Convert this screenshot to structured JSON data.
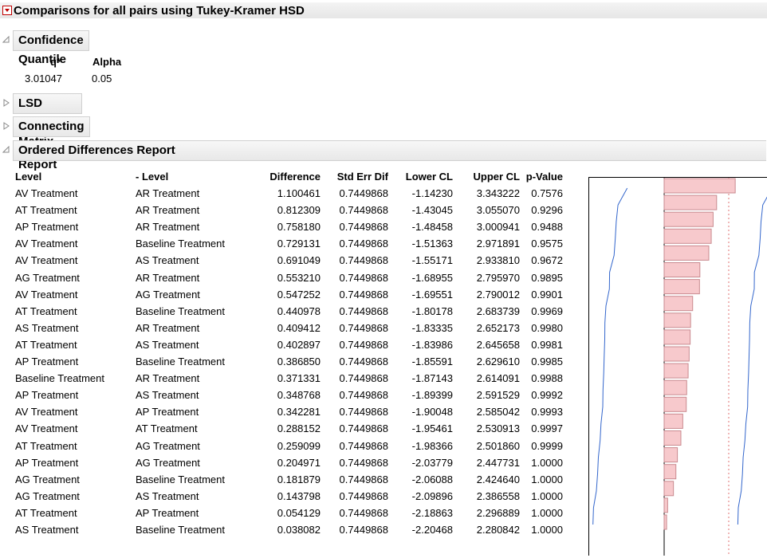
{
  "report": {
    "title": "Comparisons for all pairs using Tukey-Kramer HSD"
  },
  "confidence_quantile": {
    "title": "Confidence Quantile",
    "headers": [
      "q*",
      "Alpha"
    ],
    "values": [
      "3.01047",
      "0.05"
    ]
  },
  "lsd_threshold": {
    "title": "LSD Threshold Matrix"
  },
  "connecting_letters": {
    "title": "Connecting Letters Report"
  },
  "ordered_differences": {
    "title": "Ordered Differences Report",
    "headers": [
      "Level",
      "- Level",
      "Difference",
      "Std Err Dif",
      "Lower CL",
      "Upper CL",
      "p-Value"
    ],
    "rows": [
      [
        "AV Treatment",
        "AR Treatment",
        "1.100461",
        "0.7449868",
        "-1.14230",
        "3.343222",
        "0.7576"
      ],
      [
        "AT Treatment",
        "AR Treatment",
        "0.812309",
        "0.7449868",
        "-1.43045",
        "3.055070",
        "0.9296"
      ],
      [
        "AP Treatment",
        "AR Treatment",
        "0.758180",
        "0.7449868",
        "-1.48458",
        "3.000941",
        "0.9488"
      ],
      [
        "AV Treatment",
        "Baseline Treatment",
        "0.729131",
        "0.7449868",
        "-1.51363",
        "2.971891",
        "0.9575"
      ],
      [
        "AV Treatment",
        "AS Treatment",
        "0.691049",
        "0.7449868",
        "-1.55171",
        "2.933810",
        "0.9672"
      ],
      [
        "AG Treatment",
        "AR Treatment",
        "0.553210",
        "0.7449868",
        "-1.68955",
        "2.795970",
        "0.9895"
      ],
      [
        "AV Treatment",
        "AG Treatment",
        "0.547252",
        "0.7449868",
        "-1.69551",
        "2.790012",
        "0.9901"
      ],
      [
        "AT Treatment",
        "Baseline Treatment",
        "0.440978",
        "0.7449868",
        "-1.80178",
        "2.683739",
        "0.9969"
      ],
      [
        "AS Treatment",
        "AR Treatment",
        "0.409412",
        "0.7449868",
        "-1.83335",
        "2.652173",
        "0.9980"
      ],
      [
        "AT Treatment",
        "AS Treatment",
        "0.402897",
        "0.7449868",
        "-1.83986",
        "2.645658",
        "0.9981"
      ],
      [
        "AP Treatment",
        "Baseline Treatment",
        "0.386850",
        "0.7449868",
        "-1.85591",
        "2.629610",
        "0.9985"
      ],
      [
        "Baseline Treatment",
        "AR Treatment",
        "0.371331",
        "0.7449868",
        "-1.87143",
        "2.614091",
        "0.9988"
      ],
      [
        "AP Treatment",
        "AS Treatment",
        "0.348768",
        "0.7449868",
        "-1.89399",
        "2.591529",
        "0.9992"
      ],
      [
        "AV Treatment",
        "AP Treatment",
        "0.342281",
        "0.7449868",
        "-1.90048",
        "2.585042",
        "0.9993"
      ],
      [
        "AV Treatment",
        "AT Treatment",
        "0.288152",
        "0.7449868",
        "-1.95461",
        "2.530913",
        "0.9997"
      ],
      [
        "AT Treatment",
        "AG Treatment",
        "0.259099",
        "0.7449868",
        "-1.98366",
        "2.501860",
        "0.9999"
      ],
      [
        "AP Treatment",
        "AG Treatment",
        "0.204971",
        "0.7449868",
        "-2.03779",
        "2.447731",
        "1.0000"
      ],
      [
        "AG Treatment",
        "Baseline Treatment",
        "0.181879",
        "0.7449868",
        "-2.06088",
        "2.424640",
        "1.0000"
      ],
      [
        "AG Treatment",
        "AS Treatment",
        "0.143798",
        "0.7449868",
        "-2.09896",
        "2.386558",
        "1.0000"
      ],
      [
        "AT Treatment",
        "AP Treatment",
        "0.054129",
        "0.7449868",
        "-2.18863",
        "2.296889",
        "1.0000"
      ],
      [
        "AS Treatment",
        "Baseline Treatment",
        "0.038082",
        "0.7449868",
        "-2.20468",
        "2.280842",
        "1.0000"
      ]
    ]
  },
  "colors": {
    "bar_fill": "#f7c9cc",
    "bar_stroke": "#c98a8f",
    "ci_line": "#3366cc",
    "ref_line": "#e07070",
    "menu_red": "#c00000"
  }
}
